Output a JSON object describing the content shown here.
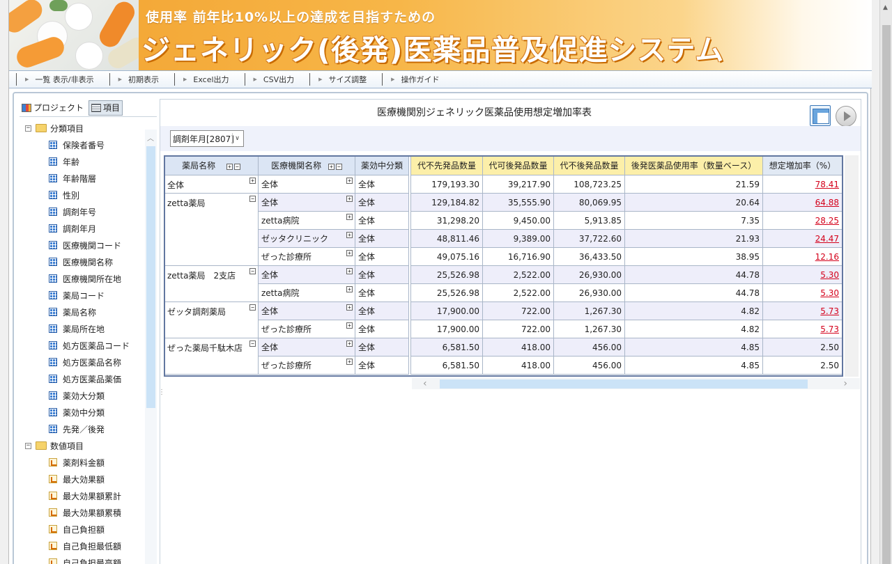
{
  "banner": {
    "subtitle": "使用率 前年比10%以上の達成を目指すための",
    "title": "ジェネリック(後発)医薬品普及促進システム"
  },
  "toolbar": {
    "buttons": [
      "一覧 表示/非表示",
      "初期表示",
      "Excel出力",
      "CSV出力",
      "サイズ調整",
      "操作ガイド"
    ]
  },
  "left_panel": {
    "tabs": [
      "プロジェクト",
      "項目"
    ],
    "groups": [
      {
        "label": "分類項目",
        "items": [
          "保険者番号",
          "年齢",
          "年齢階層",
          "性別",
          "調剤年号",
          "調剤年月",
          "医療機関コード",
          "医療機関名称",
          "医療機関所在地",
          "薬局コード",
          "薬局名称",
          "薬局所在地",
          "処方医薬品コード",
          "処方医薬品名称",
          "処方医薬品薬価",
          "薬効大分類",
          "薬効中分類",
          "先発／後発"
        ]
      },
      {
        "label": "数値項目",
        "items": [
          "薬剤料金額",
          "最大効果額",
          "最大効果額累計",
          "最大効果額累積",
          "自己負担額",
          "自己負担最低額",
          "自己負担最高額"
        ]
      }
    ]
  },
  "report": {
    "title": "医療機関別ジェネリック医薬品使用想定増加率表",
    "filter": "調剤年月[2807]",
    "dim_headers": [
      "薬局名称",
      "医療機関名称",
      "薬効中分類"
    ],
    "measure_headers": [
      "代不先発品数量",
      "代可後発品数量",
      "代不後発品数量",
      "後発医薬品使用率（数量ベース）",
      "想定増加率（%）"
    ],
    "rows": [
      {
        "pharmacy": "全体",
        "pharmacy_toggle": "+",
        "clinic": "全体",
        "category": "全体",
        "values": [
          "179,193.30",
          "39,217.90",
          "108,723.25",
          "21.59",
          "78.41"
        ],
        "link": true
      },
      {
        "pharmacy": "zetta薬局",
        "pharmacy_toggle": "−",
        "clinic": "全体",
        "category": "全体",
        "values": [
          "129,184.82",
          "35,555.90",
          "80,069.95",
          "20.64",
          "64.88"
        ],
        "link": true
      },
      {
        "pharmacy": "",
        "clinic": "zetta病院",
        "category": "全体",
        "values": [
          "31,298.20",
          "9,450.00",
          "5,913.85",
          "7.35",
          "28.25"
        ],
        "link": true
      },
      {
        "pharmacy": "",
        "clinic": "ゼッタクリニック",
        "category": "全体",
        "values": [
          "48,811.46",
          "9,389.00",
          "37,722.60",
          "21.93",
          "24.47"
        ],
        "link": true
      },
      {
        "pharmacy": "",
        "clinic": "ぜった診療所",
        "category": "全体",
        "values": [
          "49,075.16",
          "16,716.90",
          "36,433.50",
          "38.95",
          "12.16"
        ],
        "link": true
      },
      {
        "pharmacy": "zetta薬局　2支店",
        "pharmacy_toggle": "−",
        "clinic": "全体",
        "category": "全体",
        "values": [
          "25,526.98",
          "2,522.00",
          "26,930.00",
          "44.78",
          "5.30"
        ],
        "link": true
      },
      {
        "pharmacy": "",
        "clinic": "zetta病院",
        "category": "全体",
        "values": [
          "25,526.98",
          "2,522.00",
          "26,930.00",
          "44.78",
          "5.30"
        ],
        "link": true
      },
      {
        "pharmacy": "ゼッタ調剤薬局",
        "pharmacy_toggle": "−",
        "clinic": "全体",
        "category": "全体",
        "values": [
          "17,900.00",
          "722.00",
          "1,267.30",
          "4.82",
          "5.73"
        ],
        "link": true
      },
      {
        "pharmacy": "",
        "clinic": "ぜった診療所",
        "category": "全体",
        "values": [
          "17,900.00",
          "722.00",
          "1,267.30",
          "4.82",
          "5.73"
        ],
        "link": true
      },
      {
        "pharmacy": "ぜった薬局千駄木店",
        "pharmacy_toggle": "−",
        "clinic": "全体",
        "category": "全体",
        "values": [
          "6,581.50",
          "418.00",
          "456.00",
          "4.85",
          "2.50"
        ],
        "link": false
      },
      {
        "pharmacy": "",
        "clinic": "ぜった診療所",
        "category": "全体",
        "values": [
          "6,581.50",
          "418.00",
          "456.00",
          "4.85",
          "2.50"
        ],
        "link": false
      }
    ],
    "row_spans": [
      1,
      4,
      0,
      0,
      0,
      2,
      0,
      2,
      0,
      2,
      0
    ]
  },
  "colors": {
    "measure_header": "#fcefa9",
    "dim_header": "#dbe5f4",
    "link_red": "#d4001a",
    "banner_orange": "#f2a230"
  }
}
